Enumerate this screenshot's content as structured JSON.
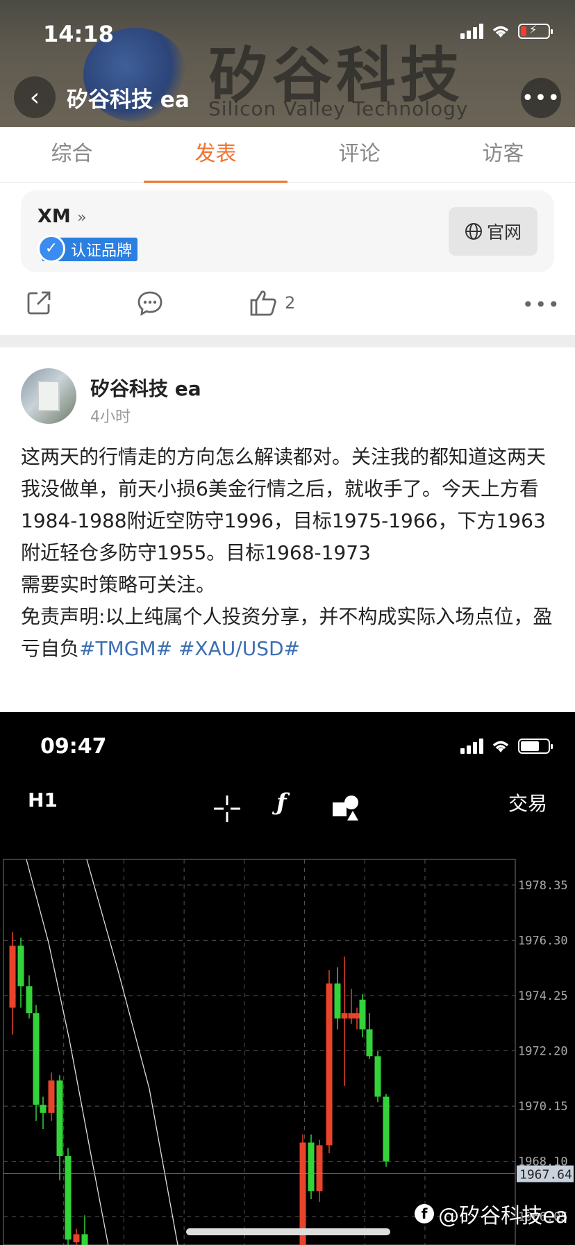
{
  "status_bar": {
    "time": "14:18"
  },
  "header": {
    "title": "矽谷科技 ea",
    "banner_text": "矽谷科技",
    "banner_subtext": "Silicon Valley Technology",
    "back_icon": "chevron-left-icon",
    "more_icon": "more-horizontal-icon"
  },
  "tabs": [
    {
      "label": "综合",
      "active": false
    },
    {
      "label": "发表",
      "active": true
    },
    {
      "label": "评论",
      "active": false
    },
    {
      "label": "访客",
      "active": false
    }
  ],
  "accent_color": "#f0742f",
  "brand_card": {
    "name": "XM",
    "name_suffix": "»",
    "badge": "认证品牌",
    "site_button": "官网"
  },
  "actions": {
    "share_icon": "share-icon",
    "comment_icon": "comment-icon",
    "like_icon": "thumbs-up-icon",
    "like_count": "2",
    "more_icon": "more-horizontal-icon"
  },
  "post": {
    "author": "矽谷科技 ea",
    "time": "4小时",
    "lines": [
      "这两天的行情走的方向怎么解读都对。关注我的都知道这两天我没做单，前天小损6美金行情之后，就收手了。今天上方看1984-1988附近空防守1996，目标1975-1966，下方1963附近轻仓多防守1955。目标1968-1973",
      "需要实时策略可关注。",
      "免责声明:以上纯属个人投资分享，并不构成实际入场点位，盈亏自负"
    ],
    "tags": [
      "#TMGM#",
      "#XAU/USD#"
    ]
  },
  "screenshot": {
    "time": "09:47",
    "timeframe": "H1",
    "trade_label": "交易",
    "watermark": "@矽谷科技ea",
    "price_current": "1967.64"
  },
  "chart_data": {
    "type": "candlestick",
    "yticks": [
      "1978.35",
      "1976.30",
      "1974.25",
      "1972.20",
      "1970.15",
      "1968.10",
      "1966.05"
    ],
    "ylim": [
      1965.0,
      1979.3
    ],
    "current_price": 1967.64,
    "candles": [
      {
        "o": 1973.8,
        "h": 1976.6,
        "l": 1972.8,
        "c": 1976.1,
        "color": "red"
      },
      {
        "o": 1976.1,
        "h": 1976.4,
        "l": 1973.8,
        "c": 1974.6,
        "color": "green"
      },
      {
        "o": 1974.6,
        "h": 1975.0,
        "l": 1973.4,
        "c": 1973.6,
        "color": "green"
      },
      {
        "o": 1973.6,
        "h": 1973.9,
        "l": 1969.6,
        "c": 1970.2,
        "color": "green"
      },
      {
        "o": 1970.2,
        "h": 1970.5,
        "l": 1969.3,
        "c": 1969.9,
        "color": "green"
      },
      {
        "o": 1969.9,
        "h": 1971.4,
        "l": 1969.6,
        "c": 1971.1,
        "color": "red"
      },
      {
        "o": 1971.1,
        "h": 1971.3,
        "l": 1967.4,
        "c": 1968.3,
        "color": "green"
      },
      {
        "o": 1968.3,
        "h": 1968.6,
        "l": 1965.0,
        "c": 1965.2,
        "color": "green"
      },
      {
        "o": 1965.1,
        "h": 1965.6,
        "l": 1964.8,
        "c": 1965.4,
        "color": "red"
      },
      {
        "o": 1965.4,
        "h": 1966.1,
        "l": 1964.7,
        "c": 1964.9,
        "color": "green"
      },
      {
        "o": 1964.9,
        "h": 1969.1,
        "l": 1964.5,
        "c": 1968.8,
        "color": "red"
      },
      {
        "o": 1968.8,
        "h": 1969.1,
        "l": 1966.7,
        "c": 1967.0,
        "color": "green"
      },
      {
        "o": 1967.0,
        "h": 1968.9,
        "l": 1966.6,
        "c": 1968.7,
        "color": "red"
      },
      {
        "o": 1968.7,
        "h": 1975.2,
        "l": 1968.4,
        "c": 1974.7,
        "color": "red"
      },
      {
        "o": 1974.7,
        "h": 1975.3,
        "l": 1973.0,
        "c": 1973.4,
        "color": "green"
      },
      {
        "o": 1973.4,
        "h": 1975.7,
        "l": 1970.9,
        "c": 1973.6,
        "color": "red"
      },
      {
        "o": 1973.6,
        "h": 1974.5,
        "l": 1973.2,
        "c": 1973.4,
        "color": "red"
      },
      {
        "o": 1973.4,
        "h": 1973.8,
        "l": 1973.0,
        "c": 1973.6,
        "color": "red"
      },
      {
        "o": 1974.1,
        "h": 1974.3,
        "l": 1972.7,
        "c": 1973.0,
        "color": "green"
      },
      {
        "o": 1973.0,
        "h": 1973.6,
        "l": 1971.9,
        "c": 1972.0,
        "color": "green"
      },
      {
        "o": 1972.0,
        "h": 1972.2,
        "l": 1970.3,
        "c": 1970.5,
        "color": "green"
      },
      {
        "o": 1970.5,
        "h": 1970.6,
        "l": 1967.9,
        "c": 1968.1,
        "color": "green"
      }
    ]
  }
}
